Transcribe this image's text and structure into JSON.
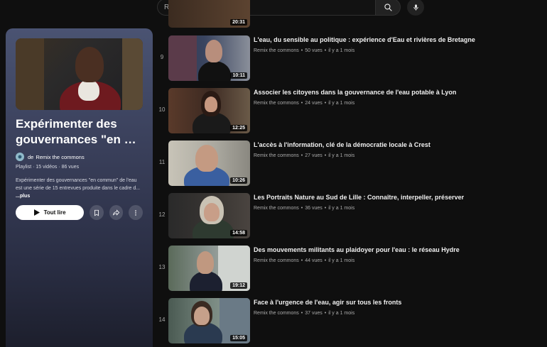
{
  "search": {
    "placeholder": "Rechercher"
  },
  "playlist": {
    "title": "Expérimenter des gouvernances \"en …",
    "owner_prefix": "de",
    "owner": "Remix the commons",
    "meta": "Playlist · 15 vidéos · 86 vues",
    "description": "Expérimenter des gouvernances \"en commun\" de l'eau est une série de 15 entrevues produite dans le cadre d...",
    "more_label": "...plus",
    "play_all_label": "Tout lire"
  },
  "partial_item": {
    "duration": "20:31"
  },
  "videos": [
    {
      "index": "9",
      "title": "L'eau, du sensible au politique : expérience d'Eau et rivières de Bretagne",
      "channel": "Remix the commons",
      "views": "50 vues",
      "age": "il y a 1 mois",
      "duration": "10:11"
    },
    {
      "index": "10",
      "title": "Associer les citoyens dans la gouvernance de l'eau potable à Lyon",
      "channel": "Remix the commons",
      "views": "24 vues",
      "age": "il y a 1 mois",
      "duration": "12:25"
    },
    {
      "index": "11",
      "title": "L'accès à l'information, clé de la démocratie locale à Crest",
      "channel": "Remix the commons",
      "views": "27 vues",
      "age": "il y a 1 mois",
      "duration": "10:26"
    },
    {
      "index": "12",
      "title": "Les Portraits Nature au Sud de Lille : Connaître, interpeller, préserver",
      "channel": "Remix the commons",
      "views": "36 vues",
      "age": "il y a 1 mois",
      "duration": "14:58"
    },
    {
      "index": "13",
      "title": "Des mouvements militants au plaidoyer pour l'eau : le réseau Hydre",
      "channel": "Remix the commons",
      "views": "44 vues",
      "age": "il y a 1 mois",
      "duration": "19:12"
    },
    {
      "index": "14",
      "title": "Face à l'urgence de l'eau, agir sur tous les fronts",
      "channel": "Remix the commons",
      "views": "37 vues",
      "age": "il y a 1 mois",
      "duration": "15:05"
    }
  ]
}
